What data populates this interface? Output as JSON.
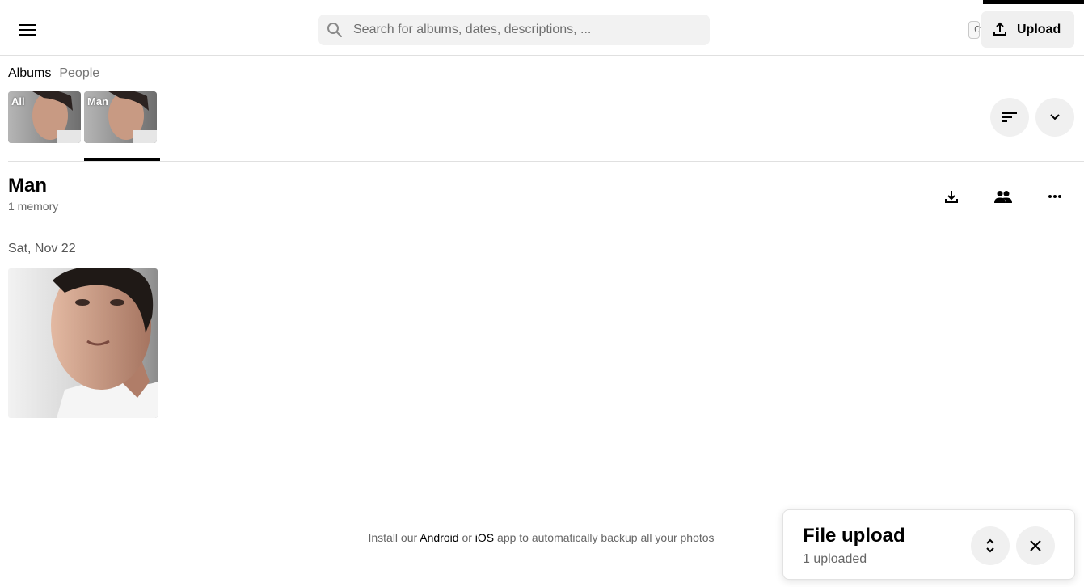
{
  "header": {
    "search_placeholder": "Search for albums, dates, descriptions, ...",
    "search_shortcut": "Ctrl + K",
    "upload_label": "Upload"
  },
  "tabs": [
    {
      "label": "Albums",
      "active": true
    },
    {
      "label": "People",
      "active": false
    }
  ],
  "albums": [
    {
      "label": "All",
      "selected": false
    },
    {
      "label": "Man",
      "selected": true
    }
  ],
  "album": {
    "title": "Man",
    "count": "1 memory"
  },
  "groups": [
    {
      "date": "Sat, Nov 22",
      "photos": 1
    }
  ],
  "footer": {
    "prefix": "Install our ",
    "android": "Android",
    "mid": " or ",
    "ios": "iOS",
    "suffix": " app to automatically backup all your photos"
  },
  "upload_panel": {
    "title": "File upload",
    "status": "1 uploaded"
  },
  "icons": {
    "menu": "menu-icon",
    "search": "search-icon",
    "upload": "upload-icon",
    "sort": "sort-icon",
    "expand": "chevron-down-icon",
    "download": "download-icon",
    "share": "people-icon",
    "more": "more-horizontal-icon",
    "collapse": "expand-collapse-icon",
    "close": "close-icon"
  }
}
